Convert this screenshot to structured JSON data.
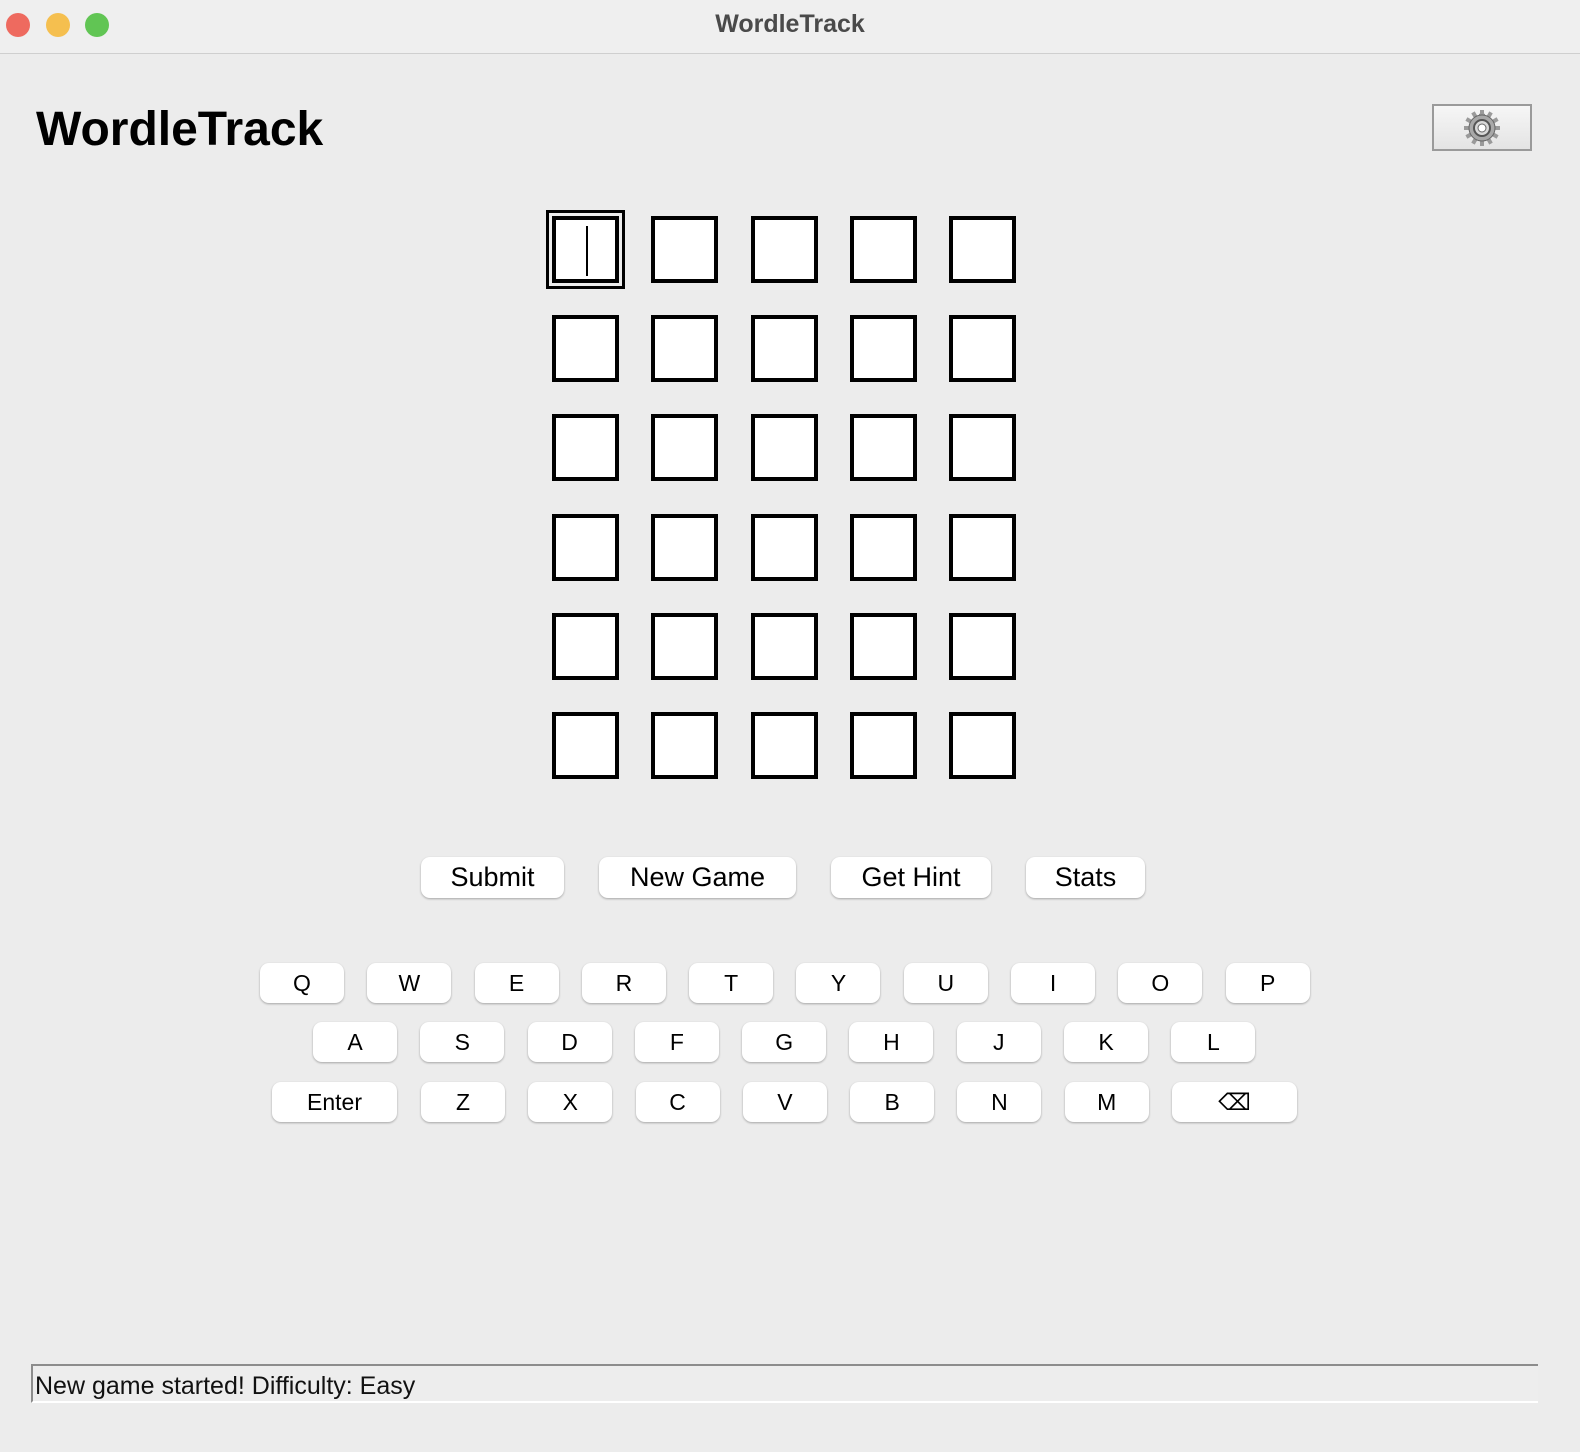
{
  "window": {
    "title": "WordleTrack",
    "traffic_lights": {
      "close": "#ee6a5f",
      "minimize": "#f5bf4f",
      "zoom": "#61c554"
    }
  },
  "header": {
    "title": "WordleTrack",
    "settings_icon": "gear-icon"
  },
  "board": {
    "rows": 6,
    "cols": 5,
    "active_cell": [
      0,
      0
    ]
  },
  "actions": {
    "submit": "Submit",
    "new_game": "New Game",
    "get_hint": "Get Hint",
    "stats": "Stats"
  },
  "keyboard": {
    "row1": [
      "Q",
      "W",
      "E",
      "R",
      "T",
      "Y",
      "U",
      "I",
      "O",
      "P"
    ],
    "row2": [
      "A",
      "S",
      "D",
      "F",
      "G",
      "H",
      "J",
      "K",
      "L"
    ],
    "row3": [
      "Enter",
      "Z",
      "X",
      "C",
      "V",
      "B",
      "N",
      "M",
      "⌫"
    ]
  },
  "status": {
    "message": "New game started! Difficulty: Easy"
  }
}
